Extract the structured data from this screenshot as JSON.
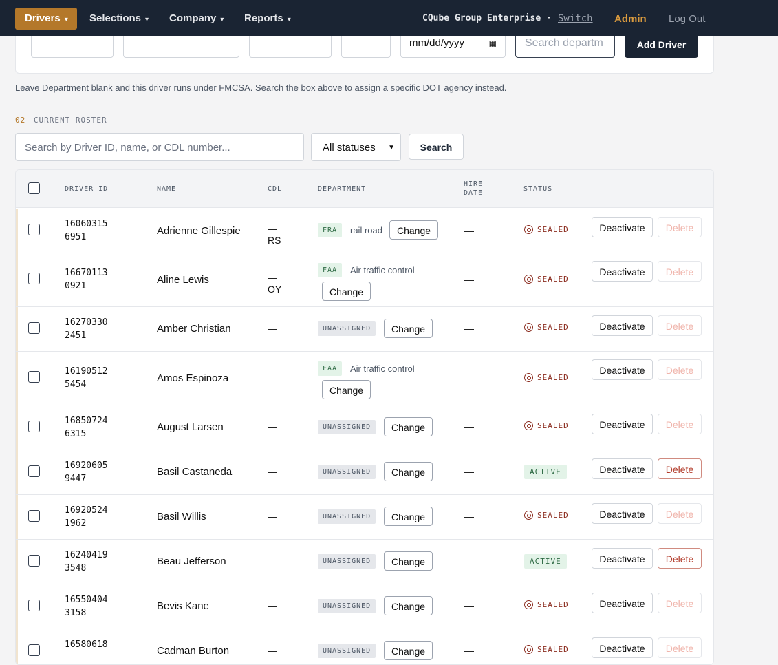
{
  "nav": {
    "items": [
      {
        "label": "Drivers",
        "caret": "▾"
      },
      {
        "label": "Selections",
        "caret": "▾"
      },
      {
        "label": "Company",
        "caret": "▾"
      },
      {
        "label": "Reports",
        "caret": "▾"
      }
    ],
    "company_name": "CQube Group Enterprise ·",
    "switch_label": "Switch",
    "admin_label": "Admin",
    "logout_label": "Log Out",
    "accent_color": "#b4782a"
  },
  "add_form": {
    "date_placeholder": "mm/dd/yyyy",
    "department_placeholder": "Search departm",
    "add_button_label": "Add Driver",
    "helper_text": "Leave Department blank and this driver runs under FMCSA. Search the box above to assign a specific DOT agency instead."
  },
  "roster": {
    "section_number": "02",
    "section_title": "CURRENT ROSTER",
    "search_placeholder": "Search by Driver ID, name, or CDL number...",
    "status_filter_value": "All statuses",
    "search_button_label": "Search"
  },
  "table": {
    "headers": {
      "driver_id": "DRIVER ID",
      "name": "NAME",
      "cdl": "CDL",
      "department": "DEPARTMENT",
      "hire_date_line1": "HIRE",
      "hire_date_line2": "DATE",
      "status": "STATUS"
    },
    "change_label": "Change",
    "deactivate_label": "Deactivate",
    "delete_label": "Delete",
    "rows": [
      {
        "id_line1": "16060315",
        "id_line2": "6951",
        "name": "Adrienne Gillespie",
        "cdl_line1": "—",
        "cdl_line2": "RS",
        "dept_tag": "FRA",
        "dept_name": "rail road",
        "hire_date": "—",
        "status": "SEALED"
      },
      {
        "id_line1": "16670113",
        "id_line2": "0921",
        "name": "Aline Lewis",
        "cdl_line1": "—",
        "cdl_line2": "OY",
        "dept_tag": "FAA",
        "dept_name": "Air traffic control",
        "hire_date": "—",
        "status": "SEALED"
      },
      {
        "id_line1": "16270330",
        "id_line2": "2451",
        "name": "Amber Christian",
        "cdl": "—",
        "dept_tag": "UNASSIGNED",
        "hire_date": "—",
        "status": "SEALED"
      },
      {
        "id_line1": "16190512",
        "id_line2": "5454",
        "name": "Amos Espinoza",
        "cdl": "—",
        "dept_tag": "FAA",
        "dept_name": "Air traffic control",
        "hire_date": "—",
        "status": "SEALED"
      },
      {
        "id_line1": "16850724",
        "id_line2": "6315",
        "name": "August Larsen",
        "cdl": "—",
        "dept_tag": "UNASSIGNED",
        "hire_date": "—",
        "status": "SEALED"
      },
      {
        "id_line1": "16920605",
        "id_line2": "9447",
        "name": "Basil Castaneda",
        "cdl": "—",
        "dept_tag": "UNASSIGNED",
        "hire_date": "—",
        "status": "ACTIVE"
      },
      {
        "id_line1": "16920524",
        "id_line2": "1962",
        "name": "Basil Willis",
        "cdl": "—",
        "dept_tag": "UNASSIGNED",
        "hire_date": "—",
        "status": "SEALED"
      },
      {
        "id_line1": "16240419",
        "id_line2": "3548",
        "name": "Beau Jefferson",
        "cdl": "—",
        "dept_tag": "UNASSIGNED",
        "hire_date": "—",
        "status": "ACTIVE"
      },
      {
        "id_line1": "16550404",
        "id_line2": "3158",
        "name": "Bevis Kane",
        "cdl": "—",
        "dept_tag": "UNASSIGNED",
        "hire_date": "—",
        "status": "SEALED"
      },
      {
        "id_line1": "16580618",
        "id_line2": "",
        "name": "Cadman Burton",
        "cdl": "—",
        "dept_tag": "UNASSIGNED",
        "hire_date": "—",
        "status": "SEALED"
      }
    ]
  }
}
